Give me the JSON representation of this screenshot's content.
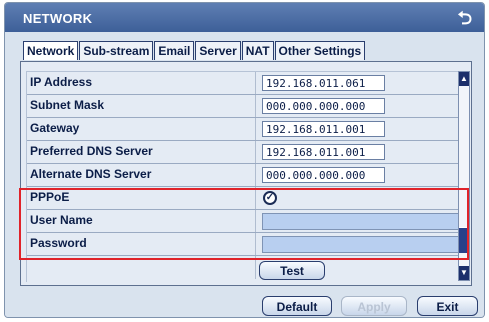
{
  "window": {
    "title": "NETWORK"
  },
  "tabs": [
    {
      "label": "Network"
    },
    {
      "label": "Sub-stream"
    },
    {
      "label": "Email"
    },
    {
      "label": "Server"
    },
    {
      "label": "NAT"
    },
    {
      "label": "Other Settings"
    }
  ],
  "fields": {
    "ip_address": {
      "label": "IP Address",
      "value": "192.168.011.061"
    },
    "subnet_mask": {
      "label": "Subnet Mask",
      "value": "000.000.000.000"
    },
    "gateway": {
      "label": "Gateway",
      "value": "192.168.011.001"
    },
    "preferred_dns": {
      "label": "Preferred DNS Server",
      "value": "192.168.011.001"
    },
    "alternate_dns": {
      "label": "Alternate DNS Server",
      "value": "000.000.000.000"
    },
    "pppoe": {
      "label": "PPPoE",
      "checked": true,
      "check_glyph": "✓"
    },
    "user_name": {
      "label": "User Name",
      "value": ""
    },
    "password": {
      "label": "Password",
      "value": ""
    }
  },
  "buttons": {
    "test": "Test",
    "default": "Default",
    "apply": "Apply",
    "exit": "Exit"
  },
  "colors": {
    "title_bar": "#4a6aa4",
    "highlight_border": "#e0232a"
  }
}
